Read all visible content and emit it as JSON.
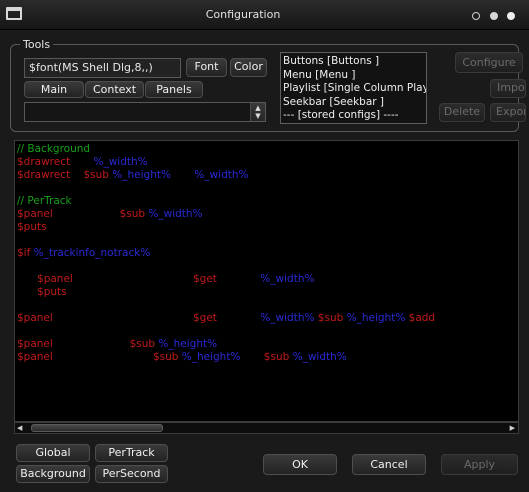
{
  "window": {
    "title": "Configuration",
    "controls": [
      "minimize-icon",
      "maximize-icon",
      "close-icon"
    ]
  },
  "tools": {
    "group_label": "Tools",
    "font_value": "$font(MS Shell Dlg,8,,)",
    "font_button": "Font",
    "color_button": "Color",
    "tabs": [
      "Main",
      "Context",
      "Panels"
    ],
    "combo_value": ""
  },
  "list": {
    "items": [
      "Buttons [Buttons ]",
      "Menu [Menu ]",
      "Playlist [Single Column Playlist",
      "Seekbar [Seekbar ]",
      "--- [stored configs] ----"
    ]
  },
  "side_buttons": {
    "configure": "Configure",
    "import": "Impor",
    "delete": "Delete",
    "export": "Expor"
  },
  "code": {
    "lines": [
      [
        {
          "t": "// Background",
          "c": "comment"
        }
      ],
      [
        {
          "t": "$drawrect",
          "c": "func"
        },
        {
          "t": "       %_width%",
          "c": "var"
        }
      ],
      [
        {
          "t": "$drawrect",
          "c": "func"
        },
        {
          "t": "    $sub",
          "c": "func"
        },
        {
          "t": " %_height%",
          "c": "var"
        },
        {
          "t": "       %_width%",
          "c": "var"
        }
      ],
      [],
      [
        {
          "t": "// PerTrack",
          "c": "comment"
        }
      ],
      [
        {
          "t": "$panel",
          "c": "func"
        },
        {
          "t": "                    $sub",
          "c": "func"
        },
        {
          "t": " %_width%",
          "c": "var"
        }
      ],
      [
        {
          "t": "$puts",
          "c": "func"
        }
      ],
      [],
      [
        {
          "t": "$if",
          "c": "func"
        },
        {
          "t": " %_trackinfo_notrack%",
          "c": "var"
        }
      ],
      [],
      [
        {
          "t": "      $panel",
          "c": "func"
        },
        {
          "t": "                                    $get",
          "c": "func"
        },
        {
          "t": "             %_width%",
          "c": "var"
        }
      ],
      [
        {
          "t": "      $puts",
          "c": "func"
        }
      ],
      [],
      [
        {
          "t": "$panel",
          "c": "func"
        },
        {
          "t": "                                          $get",
          "c": "func"
        },
        {
          "t": "             %_width%",
          "c": "var"
        },
        {
          "t": " $sub",
          "c": "func"
        },
        {
          "t": " %_height%",
          "c": "var"
        },
        {
          "t": " $add",
          "c": "func"
        }
      ],
      [],
      [
        {
          "t": "$panel",
          "c": "func"
        },
        {
          "t": "                       $sub",
          "c": "func"
        },
        {
          "t": " %_height%",
          "c": "var"
        }
      ],
      [
        {
          "t": "$panel",
          "c": "func"
        },
        {
          "t": "                              $sub",
          "c": "func"
        },
        {
          "t": " %_height%",
          "c": "var"
        },
        {
          "t": "       $sub",
          "c": "func"
        },
        {
          "t": " %_width%",
          "c": "var"
        }
      ]
    ],
    "colors": {
      "comment": "#17a01c",
      "func": "#c21a1a",
      "var": "#2a2ad6"
    }
  },
  "bottom": {
    "script_tabs": [
      "Global",
      "PerTrack",
      "Background",
      "PerSecond"
    ],
    "ok": "OK",
    "cancel": "Cancel",
    "apply": "Apply"
  },
  "colors": {
    "background": "#1a1a1a",
    "editor_background": "#000000"
  }
}
